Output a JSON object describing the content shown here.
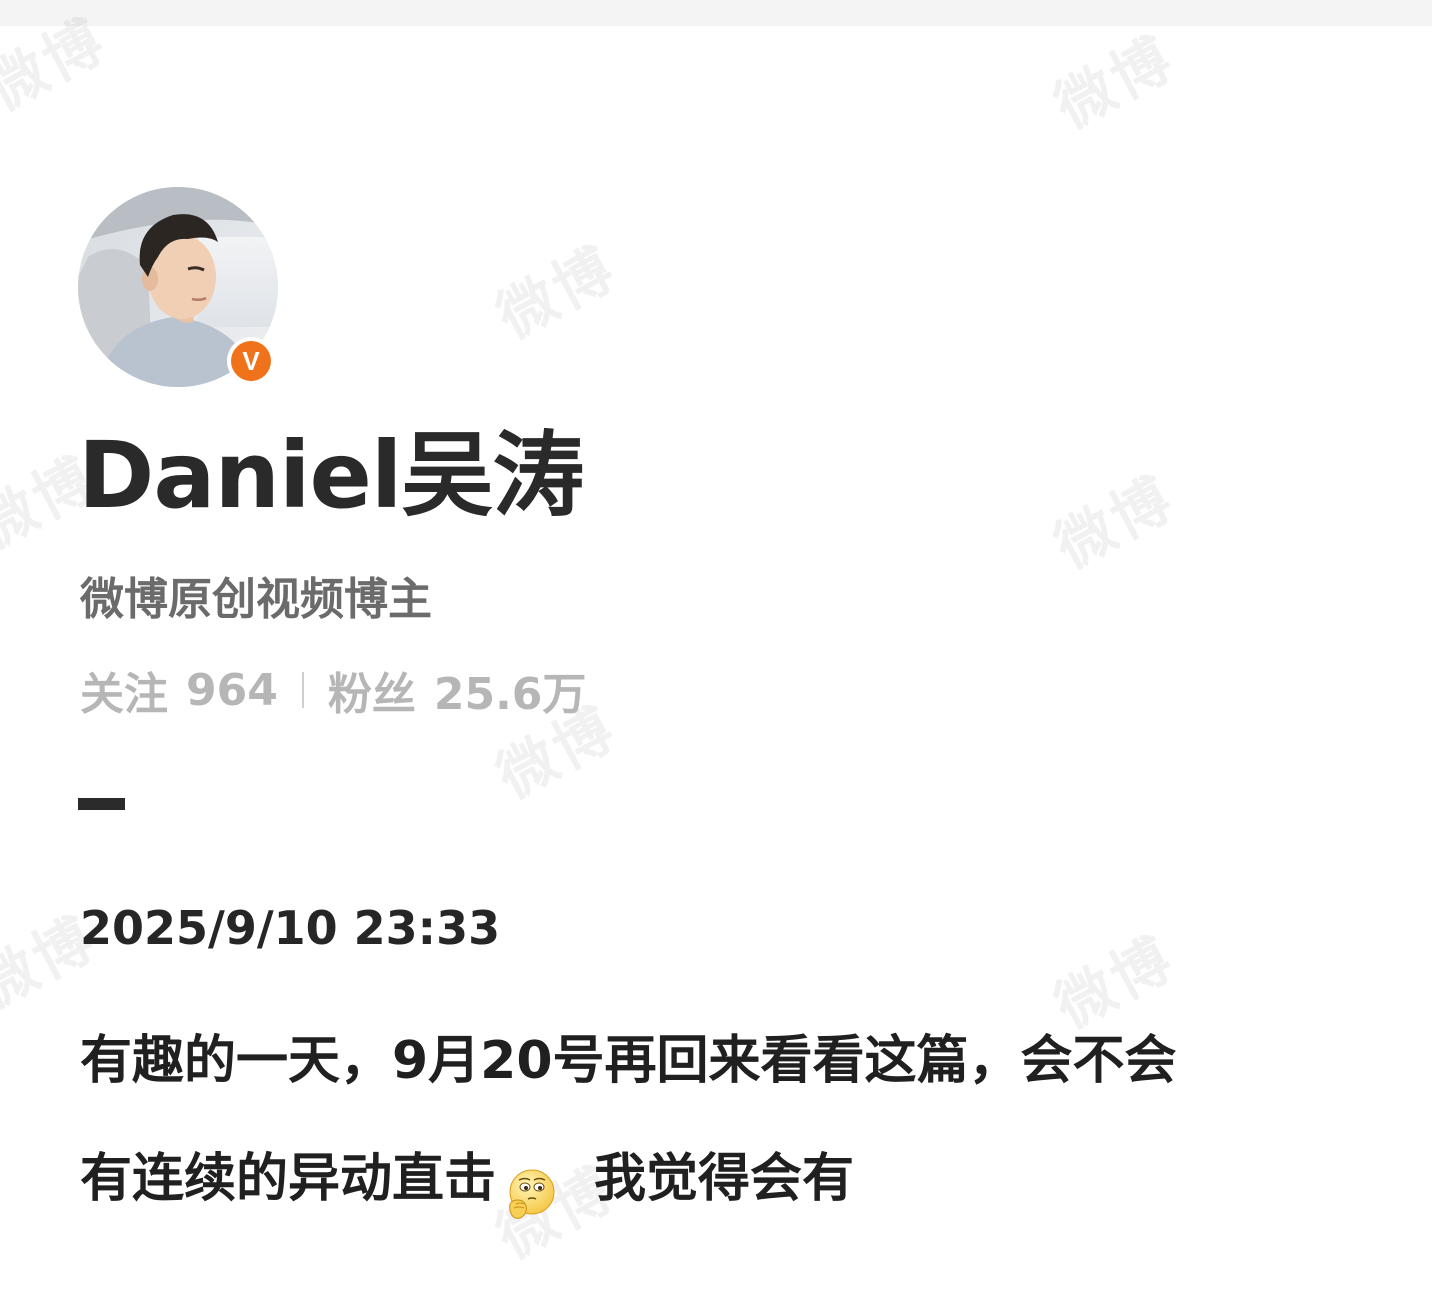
{
  "profile": {
    "display_name": "Daniel吴涛",
    "verified_title": "微博原创视频博主",
    "avatar_icon": "person-avatar",
    "verified_icon": "verified-v-icon",
    "verified_letter": "V",
    "verified_color": "#f0731c"
  },
  "stats": {
    "following_label": "关注",
    "following_count": "964",
    "followers_label": "粉丝",
    "followers_count": "25.6万"
  },
  "post": {
    "time": "2025/9/10 23:33",
    "line1": "有趣的一天，9月20号再回来看看这篇，会不会",
    "line2_before_emoji": "有连续的异动直击",
    "emoji_icon": "thinking-emoji-icon",
    "line2_after_emoji": "我觉得会有"
  },
  "watermark": {
    "text": "微博"
  }
}
